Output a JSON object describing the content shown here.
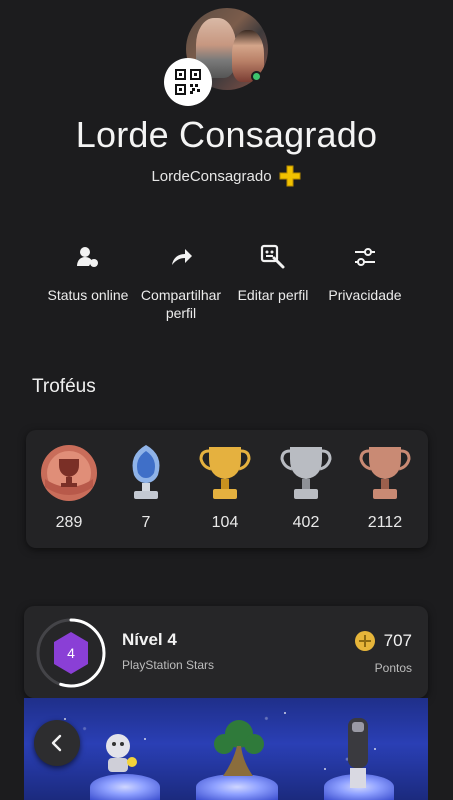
{
  "profile": {
    "display_name": "Lorde Consagrado",
    "online_id": "LordeConsagrado",
    "online_status_color": "#3ec46d",
    "plus_badge_color": "#f2c200"
  },
  "actions": [
    {
      "label": "Status online",
      "icon": "user-status-icon"
    },
    {
      "label": "Compartilhar perfil",
      "icon": "share-arrow-icon"
    },
    {
      "label": "Editar perfil",
      "icon": "edit-profile-icon"
    },
    {
      "label": "Privacidade",
      "icon": "sliders-icon"
    }
  ],
  "trophies": {
    "section_title": "Troféus",
    "items": [
      {
        "kind": "level",
        "count": "289"
      },
      {
        "kind": "platinum",
        "count": "7"
      },
      {
        "kind": "gold",
        "count": "104"
      },
      {
        "kind": "silver",
        "count": "402"
      },
      {
        "kind": "bronze",
        "count": "2112"
      }
    ]
  },
  "stars": {
    "level_number": "4",
    "level_title": "Nível 4",
    "subtitle": "PlayStation Stars",
    "points": "707",
    "points_label": "Pontos",
    "level_progress": 0.55
  }
}
